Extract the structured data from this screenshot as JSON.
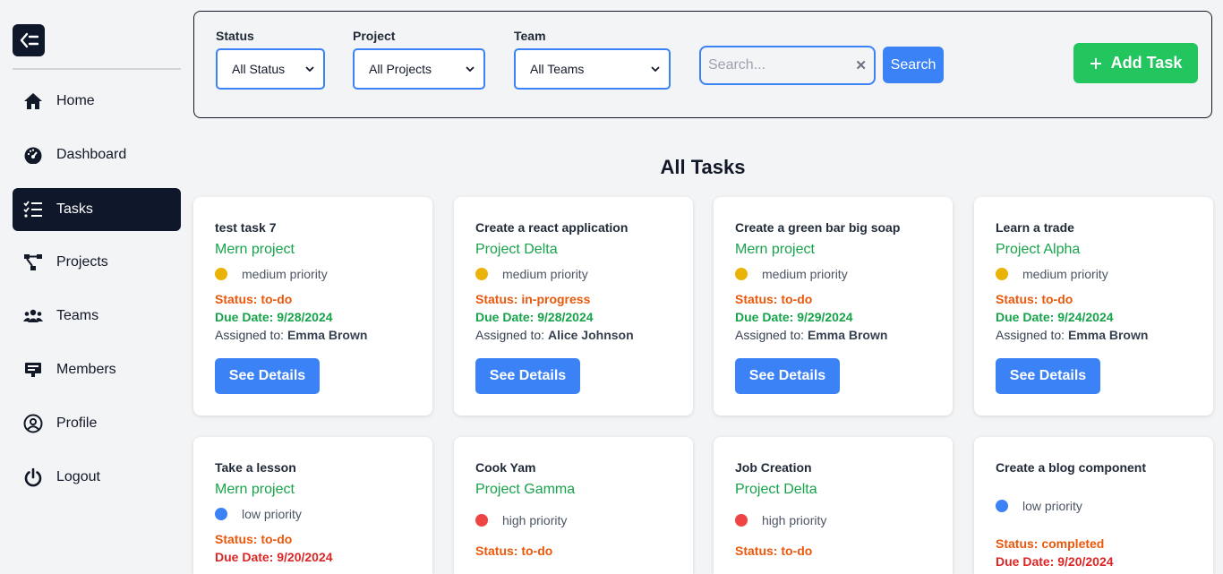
{
  "sidebar": {
    "items": [
      {
        "label": "Home",
        "icon": "home-icon"
      },
      {
        "label": "Dashboard",
        "icon": "gauge-icon"
      },
      {
        "label": "Tasks",
        "icon": "checklist-icon",
        "active": true
      },
      {
        "label": "Projects",
        "icon": "project-tree-icon"
      },
      {
        "label": "Teams",
        "icon": "users-icon"
      },
      {
        "label": "Members",
        "icon": "id-card-icon"
      },
      {
        "label": "Profile",
        "icon": "user-circle-icon"
      },
      {
        "label": "Logout",
        "icon": "power-icon"
      }
    ]
  },
  "filters": {
    "status": {
      "label": "Status",
      "value": "All Status"
    },
    "project": {
      "label": "Project",
      "value": "All Projects"
    },
    "team": {
      "label": "Team",
      "value": "All Teams"
    },
    "search": {
      "placeholder": "Search...",
      "button": "Search"
    },
    "add_task": "Add Task"
  },
  "page_title": "All Tasks",
  "colors": {
    "accent": "#3b82f6",
    "success": "#22c55e",
    "sidebar_active": "#0f172a",
    "medium": "#eab308",
    "low": "#3b82f6",
    "high": "#ef4444",
    "due_green": "#16a34a",
    "due_red": "#dc2626"
  },
  "tasks": [
    {
      "title": "test task 7",
      "project": "Mern project",
      "priority": "medium priority",
      "status": "Status: to-do",
      "due": "Due Date: 9/28/2024",
      "assigned_label": "Assigned to:",
      "assignee": "Emma Brown",
      "button": "See Details"
    },
    {
      "title": "Create a react application",
      "project": "Project Delta",
      "priority": "medium priority",
      "status": "Status: in-progress",
      "due": "Due Date: 9/28/2024",
      "assigned_label": "Assigned to:",
      "assignee": "Alice Johnson",
      "button": "See Details"
    },
    {
      "title": "Create a green bar big soap",
      "project": "Mern project",
      "priority": "medium priority",
      "status": "Status: to-do",
      "due": "Due Date: 9/29/2024",
      "assigned_label": "Assigned to:",
      "assignee": "Emma Brown",
      "button": "See Details"
    },
    {
      "title": "Learn a trade",
      "project": "Project Alpha",
      "priority": "medium priority",
      "status": "Status: to-do",
      "due": "Due Date: 9/24/2024",
      "assigned_label": "Assigned to:",
      "assignee": "Emma Brown",
      "button": "See Details"
    },
    {
      "title": "Take a lesson",
      "project": "Mern project",
      "priority": "low priority",
      "status": "Status: to-do",
      "due": "Due Date: 9/20/2024"
    },
    {
      "title": "Cook Yam",
      "project": "Project Gamma",
      "priority": "high priority",
      "status": "Status: to-do"
    },
    {
      "title": "Job Creation",
      "project": "Project Delta",
      "priority": "high priority",
      "status": "Status: to-do"
    },
    {
      "title": "Create a blog component",
      "project": "",
      "priority": "low priority",
      "status": "Status: completed",
      "due": "Due Date: 9/20/2024"
    }
  ]
}
